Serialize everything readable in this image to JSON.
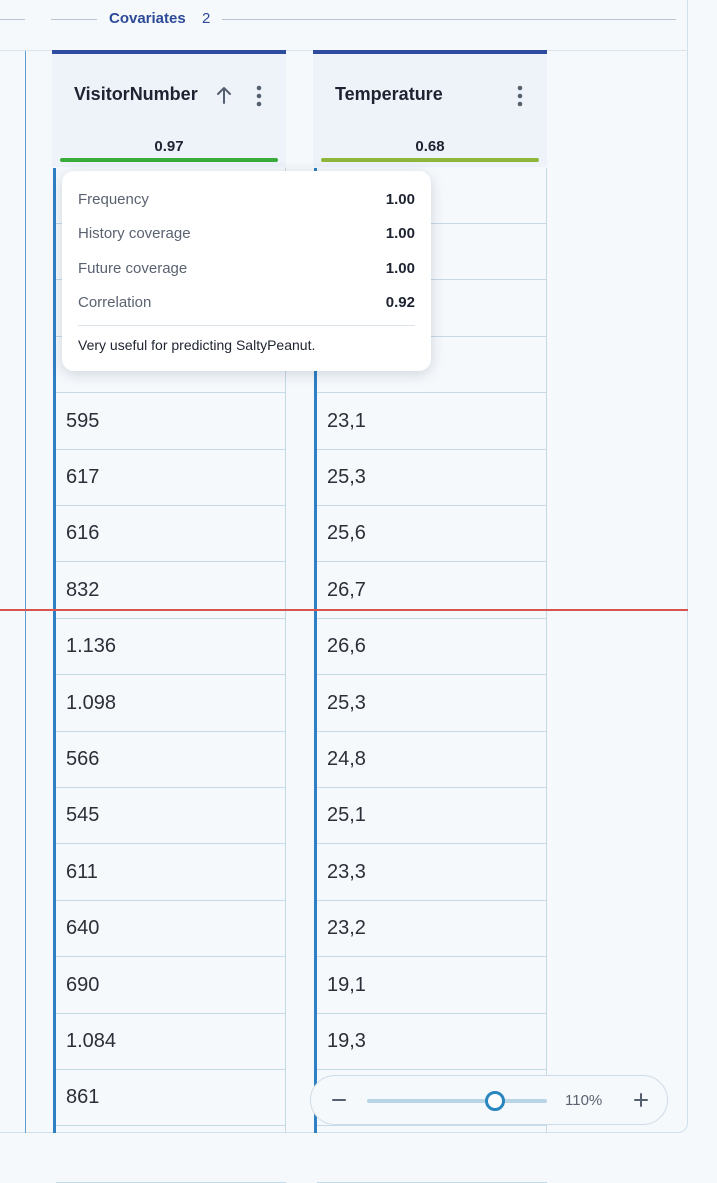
{
  "section": {
    "title": "Covariates",
    "count": "2"
  },
  "columns": [
    {
      "title": "VisitorNumber",
      "score": "0.97",
      "score_bar_color": "#3aab3a",
      "rows": [
        "",
        "",
        "",
        "",
        "595",
        "617",
        "616",
        "832",
        "1.136",
        "1.098",
        "566",
        "545",
        "611",
        "640",
        "690",
        "1.084",
        "861",
        ""
      ]
    },
    {
      "title": "Temperature",
      "score": "0.68",
      "score_bar_color": "#8db63a",
      "rows": [
        "",
        "",
        "",
        "",
        "23,1",
        "25,3",
        "25,6",
        "26,7",
        "26,6",
        "25,3",
        "24,8",
        "25,1",
        "23,3",
        "23,2",
        "19,1",
        "19,3",
        "",
        ""
      ]
    }
  ],
  "tooltip": {
    "items": [
      {
        "label": "Frequency",
        "value": "1.00"
      },
      {
        "label": "History coverage",
        "value": "1.00"
      },
      {
        "label": "Future coverage",
        "value": "1.00"
      },
      {
        "label": "Correlation",
        "value": "0.92"
      }
    ],
    "note": "Very useful for predicting SaltyPeanut."
  },
  "zoom": {
    "value": "110%",
    "level_fraction": 0.71
  },
  "icons": {
    "sort": "arrow-up-icon",
    "menu": "kebab-menu-icon",
    "zoom_out": "minus-icon",
    "zoom_in": "plus-icon"
  }
}
